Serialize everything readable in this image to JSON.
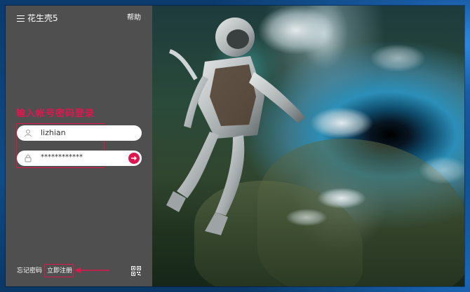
{
  "app": {
    "title": "花生壳5",
    "help": "帮助"
  },
  "annotation": {
    "heading": "输入帐号密码登录"
  },
  "login": {
    "username": "lizhian",
    "password": "************"
  },
  "footer": {
    "forgot": "忘记密码",
    "register": "立即注册"
  },
  "colors": {
    "accent": "#e0174f",
    "panel": "#4f4f4f"
  },
  "icons": {
    "menu": "menu-icon",
    "user": "user-icon",
    "lock": "lock-icon",
    "submit": "arrow-right-icon",
    "qr": "qr-code-icon"
  }
}
